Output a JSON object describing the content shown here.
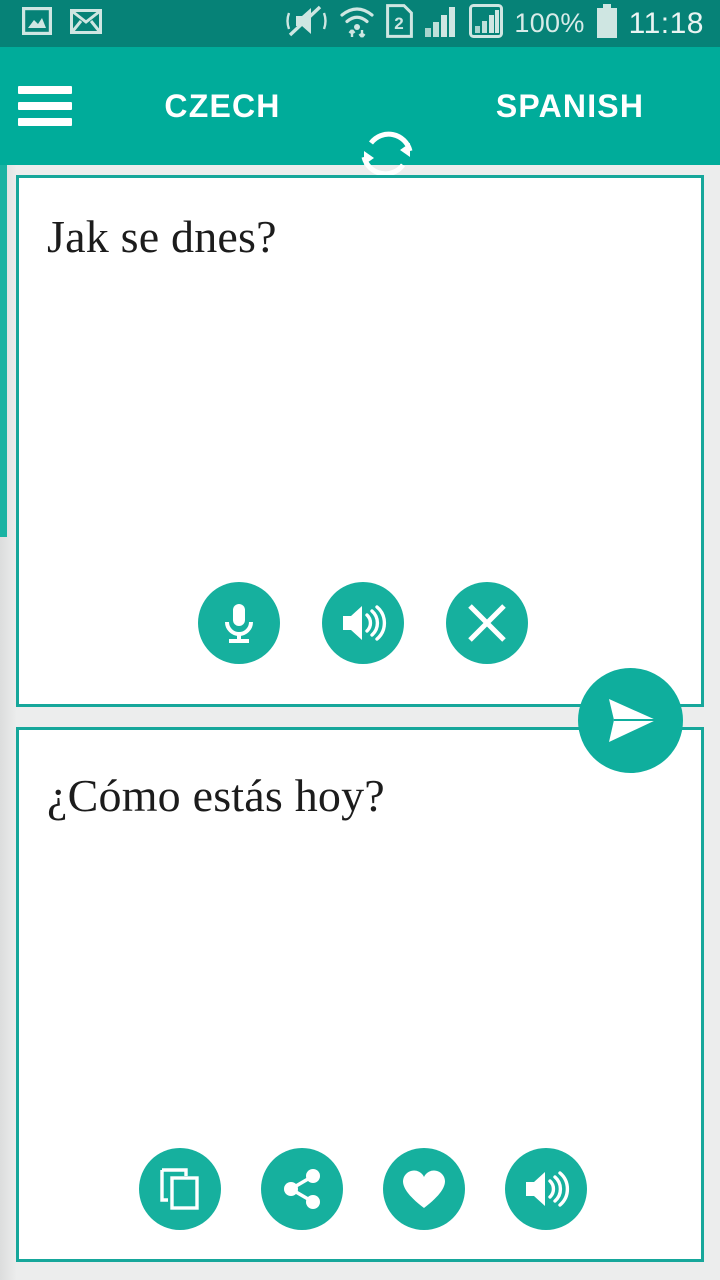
{
  "status_bar": {
    "background": "#068277",
    "left_icons": [
      {
        "name": "gallery-icon",
        "label": "Gallery"
      },
      {
        "name": "email-icon",
        "label": "Email"
      }
    ],
    "right_icons": [
      {
        "name": "mute-vibrate-icon",
        "label": "Sound off"
      },
      {
        "name": "wifi-icon",
        "label": "Wi-Fi"
      },
      {
        "name": "sim-card-2-icon",
        "label": "2"
      },
      {
        "name": "signal-bars-icon",
        "label": "Signal"
      },
      {
        "name": "signal-bars-boxed-icon",
        "label": "Signal 2"
      }
    ],
    "battery_percent": "100%",
    "clock": "11:18"
  },
  "app_bar": {
    "background": "#00ac9a",
    "menu_label": "Menu",
    "source_language": "CZECH",
    "target_language": "SPANISH",
    "swap_label": "Swap languages"
  },
  "source_panel": {
    "text": "Jak se dnes?",
    "border_color": "#16a79b",
    "actions": [
      {
        "name": "microphone-button",
        "label": "Speak"
      },
      {
        "name": "speaker-button",
        "label": "Listen"
      },
      {
        "name": "clear-button",
        "label": "Clear"
      }
    ]
  },
  "target_panel": {
    "text": "¿Cómo estás hoy?",
    "border_color": "#16a79b",
    "actions": [
      {
        "name": "copy-button",
        "label": "Copy"
      },
      {
        "name": "share-button",
        "label": "Share"
      },
      {
        "name": "favorite-button",
        "label": "Favorite"
      },
      {
        "name": "speaker-button",
        "label": "Listen"
      }
    ]
  },
  "translate_fab": {
    "label": "Translate",
    "color": "#0fae9d"
  },
  "accent_color": "#16b09e"
}
